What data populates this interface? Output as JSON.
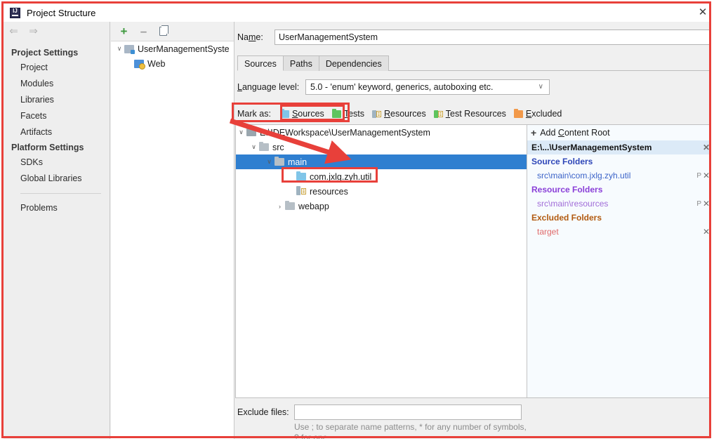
{
  "window": {
    "title": "Project Structure",
    "logo_text": "IJ",
    "close_label": "✕"
  },
  "sidebar": {
    "nav": {
      "back": "⇐",
      "forward": "⇒"
    },
    "groups": [
      {
        "title": "Project Settings",
        "items": [
          {
            "label": "Project"
          },
          {
            "label": "Modules"
          },
          {
            "label": "Libraries"
          },
          {
            "label": "Facets"
          },
          {
            "label": "Artifacts"
          }
        ]
      },
      {
        "title": "Platform Settings",
        "items": [
          {
            "label": "SDKs"
          },
          {
            "label": "Global Libraries"
          }
        ]
      }
    ],
    "footer_items": [
      {
        "label": "Problems"
      }
    ]
  },
  "modules_panel": {
    "toolbar": {
      "add": "+",
      "remove": "–",
      "copy": "copy-icon"
    },
    "tree": [
      {
        "label": "UserManagementSyste",
        "icon": "module-icon",
        "expander": "∨",
        "indent": 0
      },
      {
        "label": "Web",
        "icon": "web-facet-icon",
        "expander": "",
        "indent": 1
      }
    ]
  },
  "editor": {
    "name_label": "Name:",
    "name_label_pre": "Na",
    "name_label_mnemonic": "m",
    "name_label_post": "e:",
    "name_value": "UserManagementSystem",
    "tabs": [
      {
        "label": "Sources",
        "active": true
      },
      {
        "label": "Paths",
        "active": false
      },
      {
        "label": "Dependencies",
        "active": false
      }
    ],
    "language_level": {
      "label_pre": "",
      "label_mnemonic": "L",
      "label_post": "anguage level:",
      "label": "Language level:",
      "value": "5.0 - 'enum' keyword, generics, autoboxing etc.",
      "caret": "∨"
    },
    "mark_as": {
      "label": "Mark as:",
      "buttons": [
        {
          "label": "Sources",
          "mnemonic": "S",
          "rest": "ources",
          "icon": "folder-sources-icon"
        },
        {
          "label": "Tests",
          "mnemonic": "T",
          "rest": "ests",
          "icon": "folder-tests-icon"
        },
        {
          "label": "Resources",
          "mnemonic": "R",
          "rest": "esources",
          "icon": "folder-resources-icon"
        },
        {
          "label": "Test Resources",
          "mnemonic": "T",
          "rest": "est Resources",
          "icon": "folder-test-resources-icon"
        },
        {
          "label": "Excluded",
          "mnemonic": "E",
          "rest": "xcluded",
          "icon": "folder-excluded-icon"
        }
      ]
    },
    "folder_tree": [
      {
        "label": "E:\\IDEWorkspace\\UserManagementSystem",
        "expander": "∨",
        "indent": 0,
        "icon": "folder-root-icon",
        "selected": false
      },
      {
        "label": "src",
        "expander": "∨",
        "indent": 1,
        "icon": "folder-icon",
        "selected": false
      },
      {
        "label": "main",
        "expander": "∨",
        "indent": 2,
        "icon": "folder-icon",
        "selected": true
      },
      {
        "label": "com.jxlg.zyh.util",
        "expander": "",
        "indent": 3,
        "icon": "folder-sources-icon",
        "selected": false
      },
      {
        "label": "resources",
        "expander": "",
        "indent": 3,
        "icon": "folder-resources-icon",
        "selected": false
      },
      {
        "label": "webapp",
        "expander": "›",
        "indent": 2,
        "icon": "folder-icon",
        "selected": false
      }
    ],
    "content_roots": {
      "add_label": "Add Content Root",
      "add_mnemonic_pre": "Add ",
      "add_mnemonic": "C",
      "add_mnemonic_post": "ontent Root",
      "add_icon": "plus-icon",
      "root_path": "E:\\...\\UserManagementSystem",
      "sections": [
        {
          "header": "Source Folders",
          "entries": [
            {
              "path": "src\\main\\com.jxlg.zyh.util",
              "has_properties": true,
              "properties_label": "P",
              "remove_label": "✕"
            }
          ]
        },
        {
          "header": "Resource Folders",
          "entries": [
            {
              "path": "src\\main\\resources",
              "has_properties": true,
              "properties_label": "P",
              "remove_label": "✕"
            }
          ]
        },
        {
          "header": "Excluded Folders",
          "entries": [
            {
              "path": "target",
              "has_properties": false,
              "properties_label": "",
              "remove_label": "✕"
            }
          ]
        }
      ],
      "root_remove_label": "✕"
    },
    "exclude_files": {
      "label": "Exclude files:",
      "value": "",
      "placeholder": "",
      "hint": "Use ; to separate name patterns, * for any number of symbols, ? for one."
    }
  },
  "annotations": {
    "accent_color": "#e8403a",
    "boxes": [
      {
        "name": "mark-as-region"
      },
      {
        "name": "sources-button"
      },
      {
        "name": "package-folder"
      }
    ],
    "arrow": {
      "from": "mark-as-sources",
      "to": "main-folder"
    }
  }
}
